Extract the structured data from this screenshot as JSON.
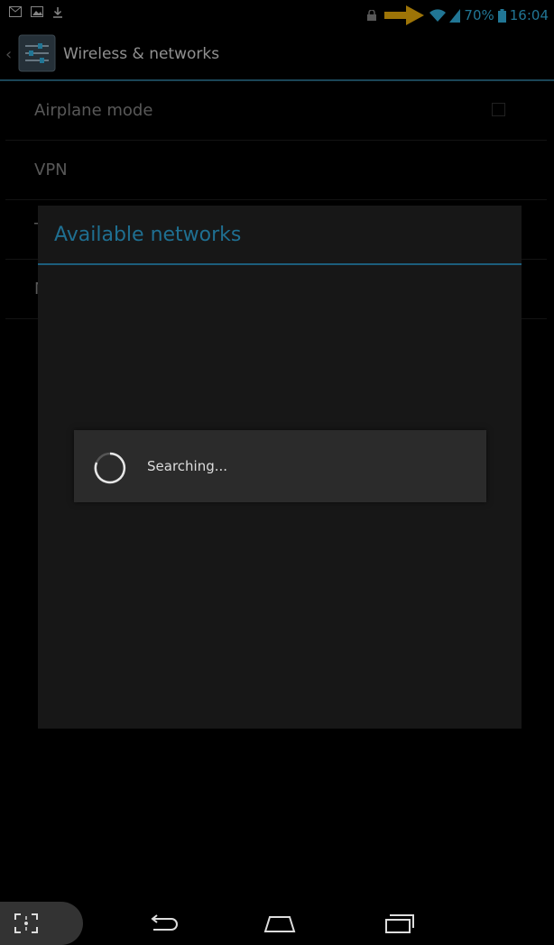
{
  "status_bar": {
    "battery": "70%",
    "time": "16:04",
    "icons": [
      "gmail-icon",
      "gallery-icon",
      "download-icon",
      "lock-icon",
      "arrow-icon",
      "wifi-icon",
      "signal-icon",
      "battery-icon"
    ],
    "accent": "#33b5e5",
    "arrow_color": "#f2b20b"
  },
  "action_bar": {
    "title": "Wireless & networks"
  },
  "settings_list": {
    "items": [
      {
        "label": "Airplane mode",
        "has_checkbox": true
      },
      {
        "label": "VPN"
      },
      {
        "label": "T"
      },
      {
        "label": "M"
      }
    ]
  },
  "dialog": {
    "title": "Available networks",
    "title_color": "#1f6f91"
  },
  "progress": {
    "message": "Searching..."
  },
  "nav_bar": {
    "icons": [
      "screenshot-icon",
      "back-icon",
      "home-icon",
      "recent-apps-icon"
    ]
  }
}
